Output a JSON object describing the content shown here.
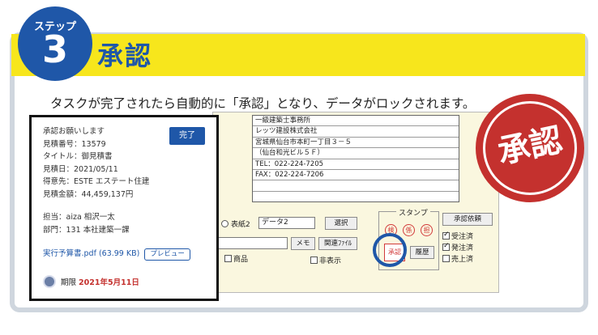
{
  "step": {
    "label": "ステップ",
    "number": "3",
    "title": "承認"
  },
  "description": "タスクが完了されたら自動的に「承認」となり、データがロックされます。",
  "colors": {
    "banner_yellow": "#f7e61c",
    "brand_blue": "#1f57a8",
    "stamp_red": "#c4312e"
  },
  "app": {
    "address_lines": [
      "一級建築士事務所",
      "レッツ建設株式会社",
      "宮城県仙台市本町一丁目３－５",
      "（仙台和光ビル５Ｆ）",
      "TEL：022-224-7205",
      "FAX：022-224-7206",
      "",
      ""
    ],
    "radio_label": "表紙2",
    "data_field_value": "データ2",
    "select_button": "選択",
    "memo_button": "メモ",
    "related_file_button": "関連ﾌｧｲﾙ",
    "product_checkbox": "商品",
    "hide_checkbox": "非表示",
    "stamp_title": "スタンプ",
    "stamp_symbols": [
      "検",
      "係",
      "担"
    ],
    "approve_stamp": "承認",
    "history_button": "履歴",
    "approval_request_button": "承認依頼",
    "status_checks": [
      {
        "label": "受注済",
        "checked": true
      },
      {
        "label": "発注済",
        "checked": true
      },
      {
        "label": "売上済",
        "checked": false
      }
    ]
  },
  "big_stamp_text": "承認",
  "notification": {
    "lines": [
      "承認お願いします",
      "見積番号：13579",
      "タイトル：御見積書",
      "見積日：2021/05/11",
      "得意先：ESTE エステート住建",
      "見積金額：44,459,137円"
    ],
    "done_button": "完了",
    "assignee": "担当：aiza 相沢一太",
    "department": "部門：131 本社建築一課",
    "attachment": "実行予算書.pdf (63.99 KB)",
    "preview_button": "プレビュー",
    "due_label": "期限",
    "due_date": "2021年5月11日"
  }
}
